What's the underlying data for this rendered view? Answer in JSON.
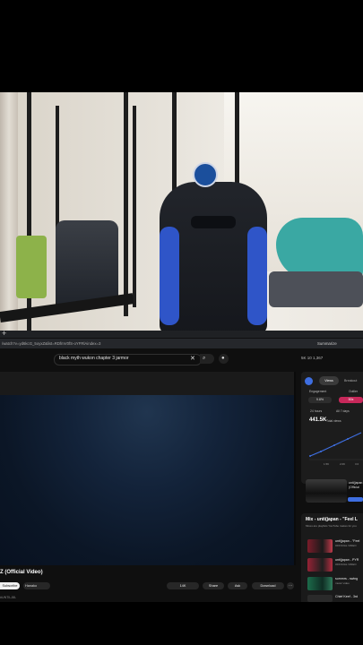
{
  "browser": {
    "new_tab_symbol": "+",
    "url": "/watch?v=yd6kcG_5oyxZ&list=RDfmV0fS-oYFRlAindex=3",
    "summarize_label": "Summarize"
  },
  "youtube": {
    "search_query": "black myth wukon chapter 3 jarmor",
    "clear_symbol": "✕",
    "search_symbol": "⌕",
    "mic_symbol": "●",
    "extension_text": "5K   10   1,367"
  },
  "video": {
    "title": "Z (Official Video)",
    "subscribe_label": "Subscribe",
    "channel_chip": "Hanako",
    "like_label": "14K",
    "share_label": "Share",
    "ask_label": "Ask",
    "download_label": "Download",
    "more_label": "⋯",
    "description_snippet": "#UNTILJ8L"
  },
  "stats_panel": {
    "tab_views": "Views",
    "tab_2": "Breakout",
    "engagement_label": "Engagement",
    "engagement_value": "9.8%",
    "outlier_label": "Outlier",
    "outlier_value": "50x",
    "hours_label": "24 hours",
    "days_label": "All 7 days",
    "total_views_value": "441.5K",
    "total_views_label": "Total views",
    "chart_ticks": [
      "1.5K",
      "2.0K",
      "3.0"
    ],
    "related_title": "unti(japan ...\n(Official"
  },
  "mix": {
    "title": "Mix - unti(japan - \"Feel L",
    "subtitle": "Mixes are playlists YouTube makes for you",
    "items": [
      {
        "line1": "unti(japan - \"Feel",
        "line2": "OFFICIAL VIDEO"
      },
      {
        "line1": "unti(japan - PYR",
        "line2": "OFFICIAL VIDEO"
      },
      {
        "line1": "summrs - swing",
        "line2": "music video"
      },
      {
        "line1": "Chief Keef - 3rd",
        "line2": ""
      }
    ]
  },
  "colors": {
    "accent_blue": "#3e6ee0",
    "outlier_pink": "#c7285a",
    "chair_blue": "#2f55c8"
  }
}
